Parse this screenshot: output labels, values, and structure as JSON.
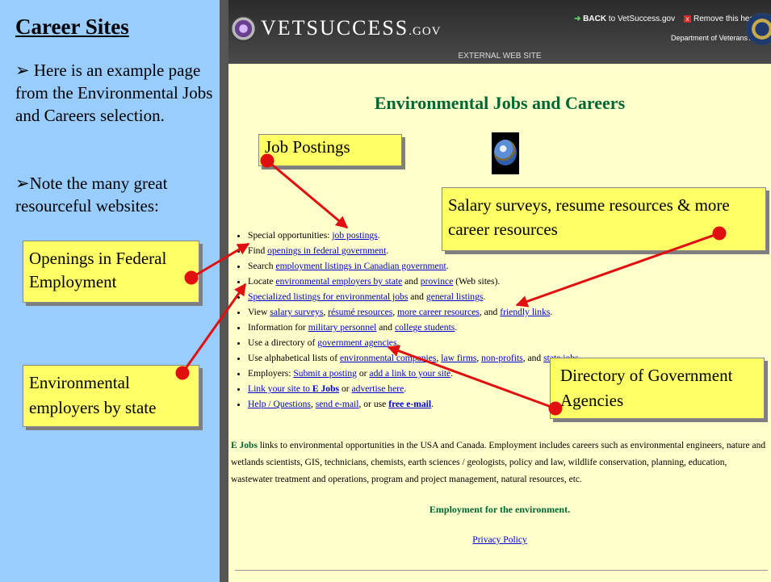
{
  "slide": {
    "title": "Career Sites",
    "bullet1": "Here is an example page from the Environmental Jobs and Careers selection.",
    "bullet2": "Note the many great resourceful websites:",
    "bullet_symbol": "➢"
  },
  "site_header": {
    "logo_main": "VetSuccess",
    "logo_suffix": ".gov",
    "back_bold": "BACK",
    "back_rest": " to VetSuccess.gov",
    "remove": "Remove this header",
    "department": "Department of Veterans Affairs",
    "external": "EXTERNAL WEB SITE"
  },
  "page": {
    "title": "Environmental Jobs and Careers",
    "links": {
      "l1_pre": "Special opportunities: ",
      "l1_a": "job postings",
      "l1_post": ".",
      "l2_pre": "Find ",
      "l2_a": "openings in federal government",
      "l2_post": ".",
      "l3_pre": "Search ",
      "l3_a": "employment listings in Canadian government",
      "l3_post": ".",
      "l4_pre": "Locate ",
      "l4_a": "environmental employers by state",
      "l4_mid": " and ",
      "l4_b": "province",
      "l4_post": " (Web sites).",
      "l5_a": "Specialized listings for environmental jobs",
      "l5_mid": " and ",
      "l5_b": "general listings",
      "l5_post": ".",
      "l6_pre": "View ",
      "l6_a": "salary surveys",
      "l6_s1": ", ",
      "l6_b": "résumé resources",
      "l6_s2": ", ",
      "l6_c": "more career resources",
      "l6_s3": ", and ",
      "l6_d": "friendly links",
      "l6_post": ".",
      "l7_pre": "Information for ",
      "l7_a": "military personnel",
      "l7_mid": " and ",
      "l7_b": "college students",
      "l7_post": ".",
      "l8_pre": "Use a directory of ",
      "l8_a": "government agencies",
      "l8_post": ".",
      "l9_pre": "Use alphabetical lists of ",
      "l9_a": "environmental companies",
      "l9_s1": ", ",
      "l9_b": "law firms",
      "l9_s2": ", ",
      "l9_c": "non-profits",
      "l9_s3": ", and ",
      "l9_d": "state jobs",
      "l9_post": ".",
      "l10_pre": "Employers: ",
      "l10_a": "Submit a posting",
      "l10_mid": " or ",
      "l10_b": "add a link to your site",
      "l10_post": ".",
      "l11_a": "Link your site to ",
      "l11_b": "E Jobs",
      "l11_mid": " or ",
      "l11_c": "advertise here",
      "l11_post": ".",
      "l12_a": "Help / Questions",
      "l12_s1": ", ",
      "l12_b": "send e-mail",
      "l12_s2": ", or use ",
      "l12_c": "free e-mail",
      "l12_post": "."
    },
    "desc_bold": "E Jobs",
    "desc": " links to environmental opportunities in the USA and Canada. Employment includes careers such as environmental engineers, nature and wetlands scientists, GIS, technicians, chemists, earth sciences / geologists, policy and law, wildlife conservation, planning, education, wastewater treatment and operations, program and project management, natural resources, etc.",
    "slogan": "Employment for the environment.",
    "privacy": "Privacy Policy"
  },
  "callouts": {
    "jobs": "Job Postings",
    "salary": "Salary surveys, resume resources & more career resources",
    "federal": "Openings in Federal Employment",
    "envemp": "Environmental employers by state",
    "directory": "Directory of Government Agencies"
  },
  "colors": {
    "panel": "#99ccff",
    "page_bg": "#ffffcc",
    "callout": "#ffff66",
    "arrow": "#e01010",
    "title_green": "#006633",
    "link": "#0000cc"
  }
}
